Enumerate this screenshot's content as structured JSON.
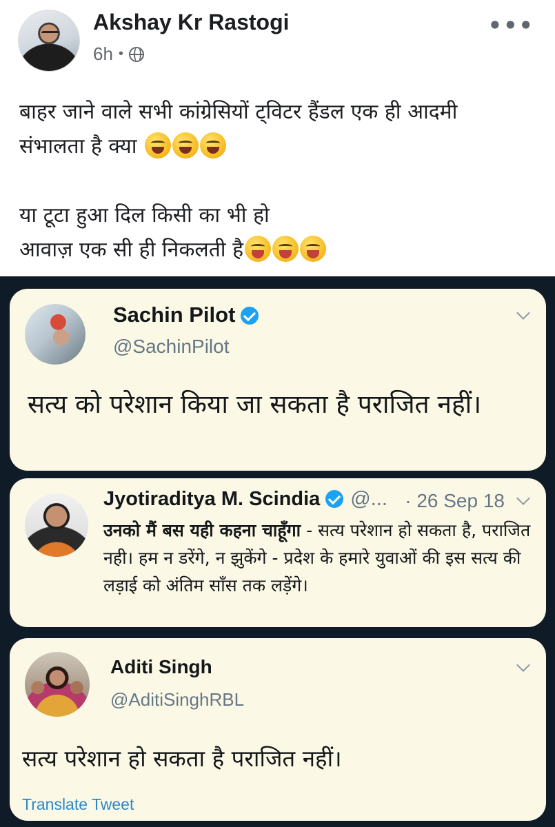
{
  "post": {
    "author": "Akshay Kr Rastogi",
    "time": "6h",
    "separator": "•",
    "privacy_icon": "globe-icon",
    "more_label": "•••",
    "lines": [
      "बाहर जाने वाले सभी कांग्रेसियों ट्विटर हैंडल एक ही आदमी",
      "संभालता है क्या",
      "या टूटा हुआ दिल किसी का भी हो",
      "आवाज़ एक सी ही निकलती है"
    ]
  },
  "tweets": [
    {
      "name": "Sachin Pilot",
      "handle": "@SachinPilot",
      "text": "सत्य को परेशान किया जा सकता है पराजित नहीं।"
    },
    {
      "name": "Jyotiraditya M. Scindia",
      "handle": "@...",
      "date": "· 26 Sep 18",
      "bold_text": "उनको मैं बस यही कहना चाहूँगा",
      "text": " - सत्य परेशान हो सकता है, पराजित नही। हम न डरेंगे, न झुकेंगे - प्रदेश के हमारे युवाओं की इस सत्य की लड़ाई को अंतिम साँस तक लड़ेंगे।"
    },
    {
      "name": "Aditi Singh",
      "handle": "@AditiSinghRBL",
      "text": "सत्य परेशान हो सकता है पराजित नहीं।",
      "translate_label": "Translate Tweet"
    }
  ],
  "colors": {
    "fb_text": "#1c1e21",
    "fb_meta": "#65676b",
    "tweet_bg": "#fbf8e6",
    "dark_bg": "#0f1b26",
    "verified": "#1da1f2",
    "link": "#2a88c8"
  }
}
